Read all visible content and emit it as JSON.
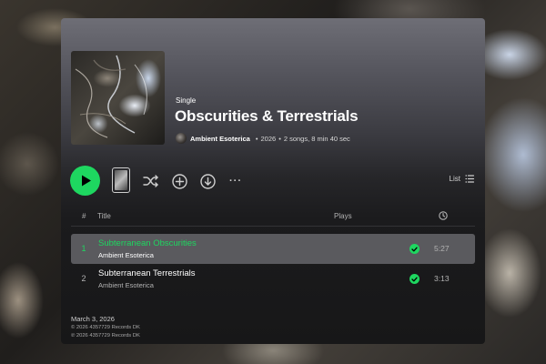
{
  "album": {
    "type_label": "Single",
    "title": "Obscurities & Terrestrials",
    "artist": "Ambient Esoterica",
    "year": "2026",
    "summary": "2 songs, 8 min 40 sec",
    "separator": "•"
  },
  "controls": {
    "play_icon": "play-icon",
    "shuffle_icon": "shuffle-icon",
    "add_icon": "plus-circle-icon",
    "download_icon": "download-icon",
    "more_icon": "more-dots-icon",
    "more_glyph": "···",
    "list_label": "List",
    "list_icon": "list-icon"
  },
  "table": {
    "col_number": "#",
    "col_title": "Title",
    "col_plays": "Plays",
    "col_duration_icon": "clock-icon"
  },
  "tracks": [
    {
      "number": "1",
      "title": "Subterranean Obscurities",
      "artist": "Ambient Esoterica",
      "plays": "",
      "duration": "5:27",
      "active": true,
      "saved": true
    },
    {
      "number": "2",
      "title": "Subterranean Terrestrials",
      "artist": "Ambient Esoterica",
      "plays": "",
      "duration": "3:13",
      "active": false,
      "saved": true
    }
  ],
  "footer": {
    "release_date": "March 3, 2026",
    "copyright_c": "© 2026 4357729 Records DK",
    "copyright_p": "℗ 2026 4357729 Records DK"
  },
  "colors": {
    "accent": "#1ed760",
    "row_highlight": "#5a5a5e"
  }
}
